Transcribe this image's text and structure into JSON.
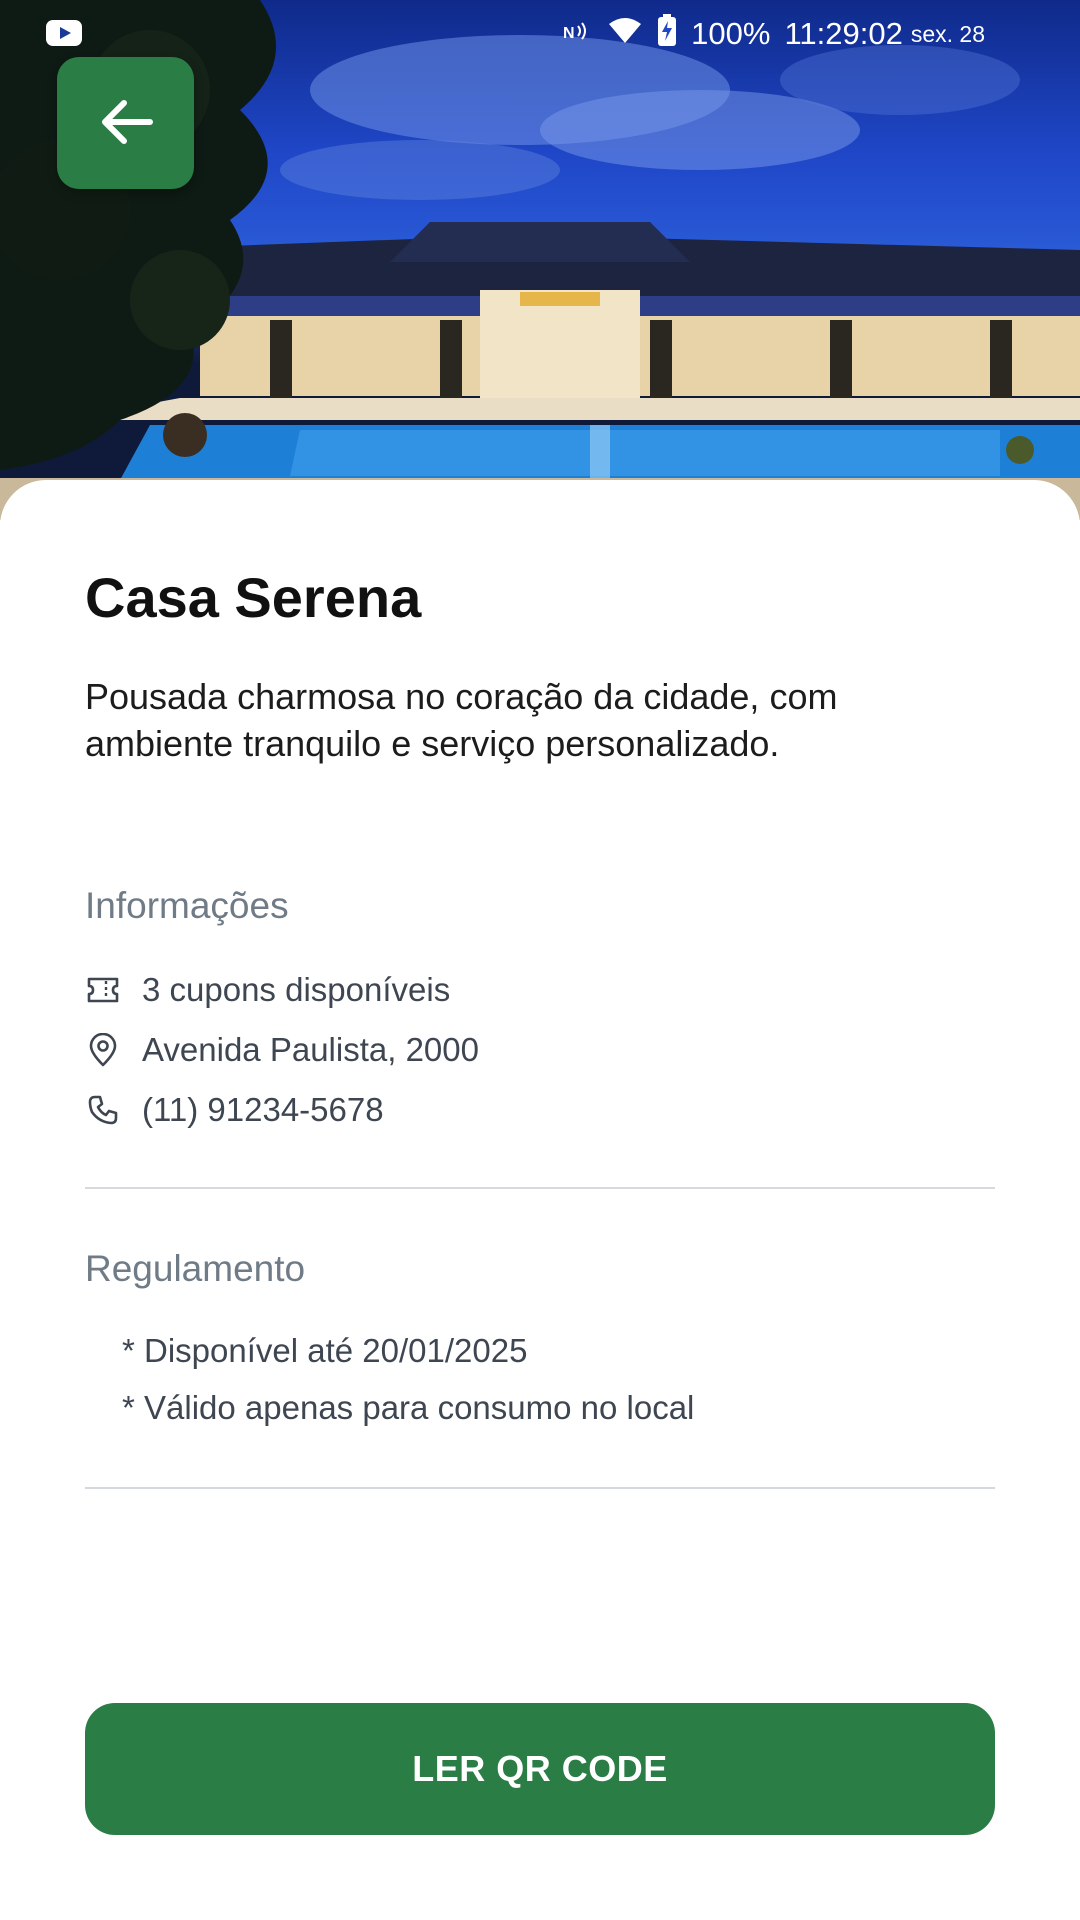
{
  "status_bar": {
    "battery": "100%",
    "time": "11:29:02",
    "date": "sex. 28",
    "icons": [
      "youtube-icon",
      "nfc-icon",
      "wifi-icon",
      "battery-charging-icon"
    ]
  },
  "hero": {
    "icon": "arrow-left-icon"
  },
  "place": {
    "title": "Casa Serena",
    "description": "Pousada charmosa no coração da cidade, com ambiente tranquilo e serviço personalizado."
  },
  "info": {
    "heading": "Informações",
    "items": [
      {
        "icon": "ticket-icon",
        "text": "3 cupons disponíveis"
      },
      {
        "icon": "location-pin-icon",
        "text": "Avenida Paulista, 2000"
      },
      {
        "icon": "phone-icon",
        "text": "(11) 91234-5678"
      }
    ]
  },
  "rules": {
    "heading": "Regulamento",
    "items": [
      "* Disponível até 20/01/2025",
      "* Válido apenas para consumo no local"
    ]
  },
  "action": {
    "label": "LER QR CODE"
  },
  "colors": {
    "primary": "#2a7d45",
    "heading_gray": "#6f7b86",
    "text_gray": "#3e4652"
  }
}
